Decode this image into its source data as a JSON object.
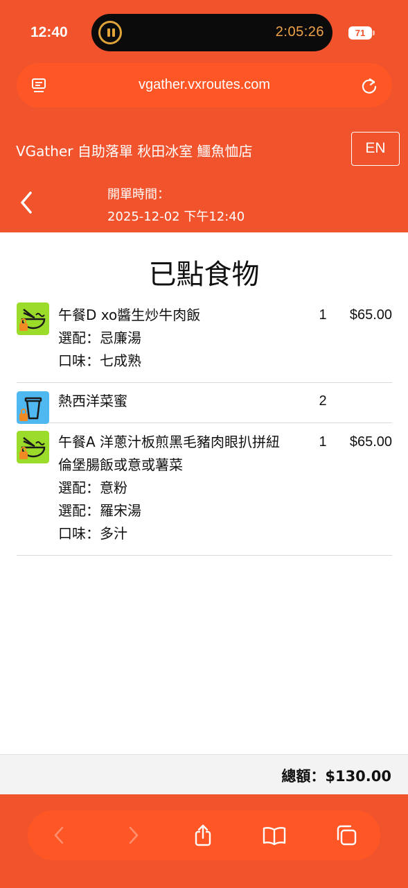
{
  "status_bar": {
    "time": "12:40",
    "live_activity_timer": "2:05:26",
    "battery": "71"
  },
  "browser": {
    "url": "vgather.vxroutes.com"
  },
  "header": {
    "site_title": "VGather 自助落單 秋田冰室 鱷魚恤店",
    "lang_button": "EN",
    "open_time_label": "開單時間：",
    "open_time_value": "2025-12-02 下午12:40"
  },
  "main": {
    "heading": "已點食物",
    "items": [
      {
        "icon": "meal-bowl-icon",
        "name": "午餐D xo醬生炒牛肉飯",
        "options": [
          "選配：忌廉湯",
          "口味：七成熟"
        ],
        "qty": "1",
        "price": "$65.00"
      },
      {
        "icon": "drink-cup-icon",
        "name": "熱西洋菜蜜",
        "options": [],
        "qty": "2",
        "price": ""
      },
      {
        "icon": "meal-bowl-icon",
        "name": "午餐A 洋蔥汁板煎黑毛豬肉眼扒拼紐倫堡腸飯或意或薯菜",
        "options": [
          "選配：意粉",
          "選配：羅宋湯",
          "口味：多汁"
        ],
        "qty": "1",
        "price": "$65.00"
      }
    ],
    "total": "總額：$130.00"
  },
  "colors": {
    "brand": "#f1532c",
    "pill": "#ff5626",
    "meal_icon_bg": "#9bdc2b",
    "drink_icon_bg": "#4fb8f0",
    "lock_badge": "#f08a24"
  },
  "toolbar_icons": [
    "back-arrow-icon",
    "forward-arrow-icon",
    "share-icon",
    "bookmarks-icon",
    "tabs-icon"
  ]
}
